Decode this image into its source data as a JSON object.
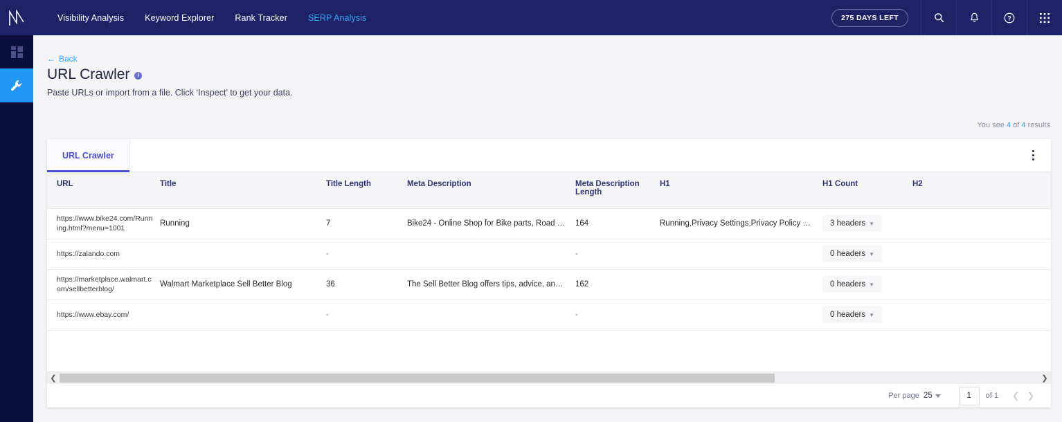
{
  "topnav": {
    "logo_icon": "brand-logo-icon",
    "links": [
      {
        "label": "Visibility Analysis",
        "active": false
      },
      {
        "label": "Keyword Explorer",
        "active": false
      },
      {
        "label": "Rank Tracker",
        "active": false
      },
      {
        "label": "SERP Analysis",
        "active": true
      }
    ],
    "trial_badge": "275 DAYS LEFT",
    "icons": [
      "search-icon",
      "notifications-bell-icon",
      "help-icon",
      "apps-grid-icon"
    ],
    "accent_color": "#35a5f0",
    "background_color": "#1e2368"
  },
  "sidebar": {
    "items": [
      {
        "name": "dashboard",
        "icon": "dashboard-grid-icon",
        "active": false
      },
      {
        "name": "tools",
        "icon": "wrench-tools-icon",
        "active": true
      }
    ],
    "active_color": "#2196f3",
    "background_color": "#0c0f3d"
  },
  "page": {
    "back_label": "Back",
    "title": "URL Crawler",
    "info_badge": "i",
    "subtitle": "Paste URLs or import from a file. Click ‘Inspect’ to get your data.",
    "results_prefix": "You see",
    "results_shown": "4",
    "results_mid": "of",
    "results_total": "4",
    "results_suffix": "results"
  },
  "card": {
    "tabs": [
      {
        "label": "URL Crawler",
        "active": true
      }
    ],
    "overflow_menu": "kebab-menu-icon"
  },
  "table": {
    "columns": [
      "URL",
      "Title",
      "Title Length",
      "Meta Description",
      "Meta Description Length",
      "H1",
      "H1 Count",
      "H2"
    ],
    "rows": [
      {
        "url": "https://www.bike24.com/Running.html?menu=1001",
        "title": "Running",
        "title_length": "7",
        "meta_description": "Bike24 - Online Shop for Bike parts, Road B...",
        "meta_description_length": "164",
        "h1": "Running,Privacy Settings,Privacy Policy of B...",
        "h1_count": "3 headers",
        "h2": ""
      },
      {
        "url": "https://zalando.com",
        "title": "",
        "title_length": "-",
        "meta_description": "",
        "meta_description_length": "-",
        "h1": "",
        "h1_count": "0 headers",
        "h2": ""
      },
      {
        "url": "https://marketplace.walmart.com/sellbetterblog/",
        "title": "Walmart Marketplace Sell Better Blog",
        "title_length": "36",
        "meta_description": "The Sell Better Blog offers tips, advice, and ...",
        "meta_description_length": "162",
        "h1": "",
        "h1_count": "0 headers",
        "h2": ""
      },
      {
        "url": "https://www.ebay.com/",
        "title": "",
        "title_length": "-",
        "meta_description": "",
        "meta_description_length": "-",
        "h1": "",
        "h1_count": "0 headers",
        "h2": ""
      }
    ]
  },
  "scrollbar": {
    "left_arrow": "chevron-left-icon",
    "right_arrow": "chevron-right-icon"
  },
  "pagination": {
    "per_page_label": "Per page",
    "per_page_value": "25",
    "page_value": "1",
    "of_label": "of 1",
    "prev_icon": "chevron-left-icon",
    "next_icon": "chevron-right-icon"
  }
}
